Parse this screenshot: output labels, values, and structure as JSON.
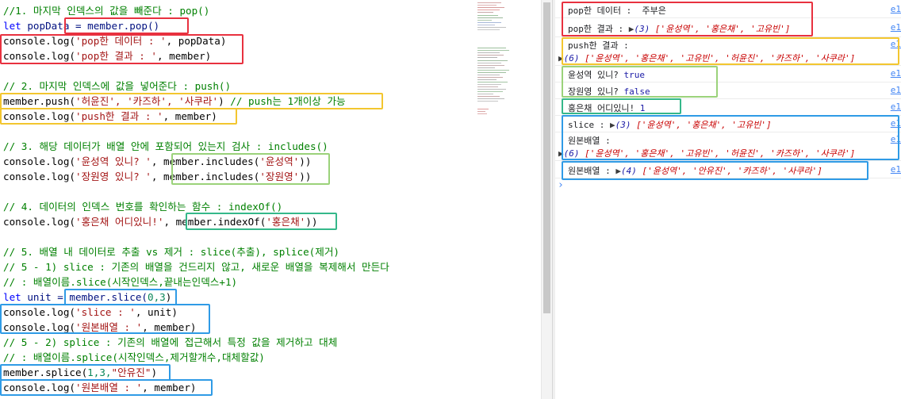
{
  "editor": {
    "lines": {
      "l1": "//1. 마지막 인덱스의 값을 빼준다 : pop()",
      "l2_kw": "let",
      "l2_var": " popData = ",
      "l2_call": "member.pop()",
      "l3_pre": "console.log(",
      "l3_str": "'pop한 데이터 : '",
      "l3_post": ", popData)",
      "l4_pre": "console.log(",
      "l4_str": "'pop한 결과 : '",
      "l4_post": ", member)",
      "l6": "// 2. 마지막 인덱스에 값을 넣어준다 : push()",
      "l7_pre": "member.push(",
      "l7_str": "'허윤진', '카즈하', '사쿠라'",
      "l7_post": ") ",
      "l7_comment": "// push는 1개이상 가능",
      "l8_pre": "console.log(",
      "l8_str": "'push한 결과 : '",
      "l8_post": ", member)",
      "l10": "// 3. 해당 데이터가 배열 안에 포함되어 있는지 검사 : includes()",
      "l11_pre": "console.log(",
      "l11_str": "'윤성역 있니? '",
      "l11_mid": ", member.includes(",
      "l11_arg": "'윤성역'",
      "l11_post": "))",
      "l12_pre": "console.log(",
      "l12_str": "'장원영 있니? '",
      "l12_mid": ", member.includes(",
      "l12_arg": "'장원영'",
      "l12_post": "))",
      "l14": "// 4. 데이터의 인덱스 번호를 확인하는 함수 : indexOf()",
      "l15_pre": "console.log(",
      "l15_str": "'홍은채 어디있니!'",
      "l15_mid": ", member.indexOf(",
      "l15_arg": "'홍은채'",
      "l15_post": "))",
      "l17": "// 5. 배열 내 데이터로 추출 vs 제거 : slice(추출), splice(제거)",
      "l18": "// 5 - 1) slice : 기존의 배열을 건드리지 않고, 새로운 배열을 복제해서 만든다",
      "l19": "// : 배열이름.slice(시작인덱스,끝내는인덱스+1)",
      "l20_kw": "let",
      "l20_var": " unit = ",
      "l20_call": "member.slice(",
      "l20_num": "0,3",
      "l20_post": ")",
      "l21_pre": "console.log(",
      "l21_str": "'slice : '",
      "l21_post": ", unit)",
      "l22_pre": "console.log(",
      "l22_str": "'원본배열 : '",
      "l22_post": ", member)",
      "l23": "// 5 - 2) splice : 기존의 배열에 접근해서 특정 값을 제거하고 대체",
      "l24": "// : 배열이름.splice(시작인덱스,제거할개수,대체할값)",
      "l25_pre": "member.splice(",
      "l25_num": "1,3,",
      "l25_str": "\"안유진\"",
      "l25_post": ")",
      "l26_pre": "console.log(",
      "l26_str": "'원본배열 : '",
      "l26_post": ", member)"
    }
  },
  "console": {
    "m1_label": "pop한 데이터 :  주부은",
    "m2_label": "pop한 결과 : ",
    "m2_count": "(3) ",
    "m2_items": "['윤성역', '홍은채', '고유빈']",
    "m3_label": "push한 결과 :",
    "m3_count": "(6) ",
    "m3_items": "['윤성역', '홍은채', '고유빈', '허윤진', '카즈하', '사쿠라']",
    "m4_label": "윤성역 있니? ",
    "m4_value": "true",
    "m5_label": "장원영 있니? ",
    "m5_value": "false",
    "m6_label": "홍은채 어디있니! ",
    "m6_value": "1",
    "m7_label": "slice : ",
    "m7_count": "(3) ",
    "m7_items": "['윤성역', '홍은채', '고유빈']",
    "m8_label": "원본배열 :",
    "m8_count": "(6) ",
    "m8_items": "['윤성역', '홍은채', '고유빈', '허윤진', '카즈하', '사쿠라']",
    "m9_label": "원본배열 : ",
    "m9_count": "(4) ",
    "m9_items": "['윤성역', '안유진', '카즈하', '사쿠라']",
    "source_link": "e1",
    "expand_arrow": "▶",
    "prompt": "›"
  },
  "colors": {
    "red": "#e8313f",
    "yellow": "#f3c62f",
    "green": "#9bd27a",
    "teal": "#35b88a",
    "blue": "#2f9be6"
  }
}
